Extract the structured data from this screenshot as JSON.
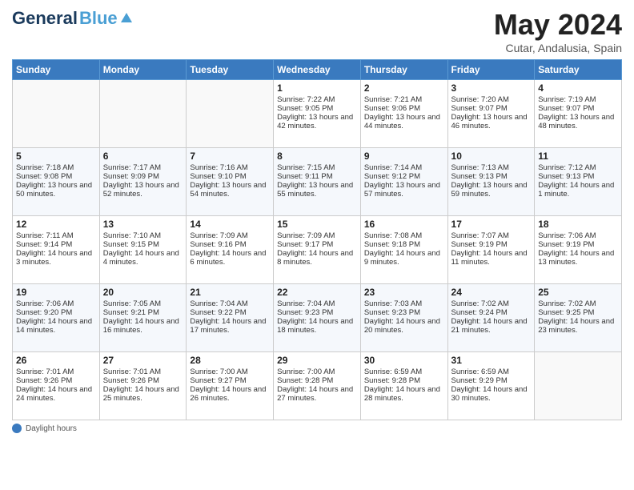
{
  "header": {
    "logo_general": "General",
    "logo_blue": "Blue",
    "main_title": "May 2024",
    "subtitle": "Cutar, Andalusia, Spain"
  },
  "calendar": {
    "weekdays": [
      "Sunday",
      "Monday",
      "Tuesday",
      "Wednesday",
      "Thursday",
      "Friday",
      "Saturday"
    ],
    "weeks": [
      [
        {
          "day": "",
          "sunrise": "",
          "sunset": "",
          "daylight": ""
        },
        {
          "day": "",
          "sunrise": "",
          "sunset": "",
          "daylight": ""
        },
        {
          "day": "",
          "sunrise": "",
          "sunset": "",
          "daylight": ""
        },
        {
          "day": "1",
          "sunrise": "Sunrise: 7:22 AM",
          "sunset": "Sunset: 9:05 PM",
          "daylight": "Daylight: 13 hours and 42 minutes."
        },
        {
          "day": "2",
          "sunrise": "Sunrise: 7:21 AM",
          "sunset": "Sunset: 9:06 PM",
          "daylight": "Daylight: 13 hours and 44 minutes."
        },
        {
          "day": "3",
          "sunrise": "Sunrise: 7:20 AM",
          "sunset": "Sunset: 9:07 PM",
          "daylight": "Daylight: 13 hours and 46 minutes."
        },
        {
          "day": "4",
          "sunrise": "Sunrise: 7:19 AM",
          "sunset": "Sunset: 9:07 PM",
          "daylight": "Daylight: 13 hours and 48 minutes."
        }
      ],
      [
        {
          "day": "5",
          "sunrise": "Sunrise: 7:18 AM",
          "sunset": "Sunset: 9:08 PM",
          "daylight": "Daylight: 13 hours and 50 minutes."
        },
        {
          "day": "6",
          "sunrise": "Sunrise: 7:17 AM",
          "sunset": "Sunset: 9:09 PM",
          "daylight": "Daylight: 13 hours and 52 minutes."
        },
        {
          "day": "7",
          "sunrise": "Sunrise: 7:16 AM",
          "sunset": "Sunset: 9:10 PM",
          "daylight": "Daylight: 13 hours and 54 minutes."
        },
        {
          "day": "8",
          "sunrise": "Sunrise: 7:15 AM",
          "sunset": "Sunset: 9:11 PM",
          "daylight": "Daylight: 13 hours and 55 minutes."
        },
        {
          "day": "9",
          "sunrise": "Sunrise: 7:14 AM",
          "sunset": "Sunset: 9:12 PM",
          "daylight": "Daylight: 13 hours and 57 minutes."
        },
        {
          "day": "10",
          "sunrise": "Sunrise: 7:13 AM",
          "sunset": "Sunset: 9:13 PM",
          "daylight": "Daylight: 13 hours and 59 minutes."
        },
        {
          "day": "11",
          "sunrise": "Sunrise: 7:12 AM",
          "sunset": "Sunset: 9:13 PM",
          "daylight": "Daylight: 14 hours and 1 minute."
        }
      ],
      [
        {
          "day": "12",
          "sunrise": "Sunrise: 7:11 AM",
          "sunset": "Sunset: 9:14 PM",
          "daylight": "Daylight: 14 hours and 3 minutes."
        },
        {
          "day": "13",
          "sunrise": "Sunrise: 7:10 AM",
          "sunset": "Sunset: 9:15 PM",
          "daylight": "Daylight: 14 hours and 4 minutes."
        },
        {
          "day": "14",
          "sunrise": "Sunrise: 7:09 AM",
          "sunset": "Sunset: 9:16 PM",
          "daylight": "Daylight: 14 hours and 6 minutes."
        },
        {
          "day": "15",
          "sunrise": "Sunrise: 7:09 AM",
          "sunset": "Sunset: 9:17 PM",
          "daylight": "Daylight: 14 hours and 8 minutes."
        },
        {
          "day": "16",
          "sunrise": "Sunrise: 7:08 AM",
          "sunset": "Sunset: 9:18 PM",
          "daylight": "Daylight: 14 hours and 9 minutes."
        },
        {
          "day": "17",
          "sunrise": "Sunrise: 7:07 AM",
          "sunset": "Sunset: 9:19 PM",
          "daylight": "Daylight: 14 hours and 11 minutes."
        },
        {
          "day": "18",
          "sunrise": "Sunrise: 7:06 AM",
          "sunset": "Sunset: 9:19 PM",
          "daylight": "Daylight: 14 hours and 13 minutes."
        }
      ],
      [
        {
          "day": "19",
          "sunrise": "Sunrise: 7:06 AM",
          "sunset": "Sunset: 9:20 PM",
          "daylight": "Daylight: 14 hours and 14 minutes."
        },
        {
          "day": "20",
          "sunrise": "Sunrise: 7:05 AM",
          "sunset": "Sunset: 9:21 PM",
          "daylight": "Daylight: 14 hours and 16 minutes."
        },
        {
          "day": "21",
          "sunrise": "Sunrise: 7:04 AM",
          "sunset": "Sunset: 9:22 PM",
          "daylight": "Daylight: 14 hours and 17 minutes."
        },
        {
          "day": "22",
          "sunrise": "Sunrise: 7:04 AM",
          "sunset": "Sunset: 9:23 PM",
          "daylight": "Daylight: 14 hours and 18 minutes."
        },
        {
          "day": "23",
          "sunrise": "Sunrise: 7:03 AM",
          "sunset": "Sunset: 9:23 PM",
          "daylight": "Daylight: 14 hours and 20 minutes."
        },
        {
          "day": "24",
          "sunrise": "Sunrise: 7:02 AM",
          "sunset": "Sunset: 9:24 PM",
          "daylight": "Daylight: 14 hours and 21 minutes."
        },
        {
          "day": "25",
          "sunrise": "Sunrise: 7:02 AM",
          "sunset": "Sunset: 9:25 PM",
          "daylight": "Daylight: 14 hours and 23 minutes."
        }
      ],
      [
        {
          "day": "26",
          "sunrise": "Sunrise: 7:01 AM",
          "sunset": "Sunset: 9:26 PM",
          "daylight": "Daylight: 14 hours and 24 minutes."
        },
        {
          "day": "27",
          "sunrise": "Sunrise: 7:01 AM",
          "sunset": "Sunset: 9:26 PM",
          "daylight": "Daylight: 14 hours and 25 minutes."
        },
        {
          "day": "28",
          "sunrise": "Sunrise: 7:00 AM",
          "sunset": "Sunset: 9:27 PM",
          "daylight": "Daylight: 14 hours and 26 minutes."
        },
        {
          "day": "29",
          "sunrise": "Sunrise: 7:00 AM",
          "sunset": "Sunset: 9:28 PM",
          "daylight": "Daylight: 14 hours and 27 minutes."
        },
        {
          "day": "30",
          "sunrise": "Sunrise: 6:59 AM",
          "sunset": "Sunset: 9:28 PM",
          "daylight": "Daylight: 14 hours and 28 minutes."
        },
        {
          "day": "31",
          "sunrise": "Sunrise: 6:59 AM",
          "sunset": "Sunset: 9:29 PM",
          "daylight": "Daylight: 14 hours and 30 minutes."
        },
        {
          "day": "",
          "sunrise": "",
          "sunset": "",
          "daylight": ""
        }
      ]
    ]
  },
  "footer": {
    "daylight_label": "Daylight hours"
  }
}
